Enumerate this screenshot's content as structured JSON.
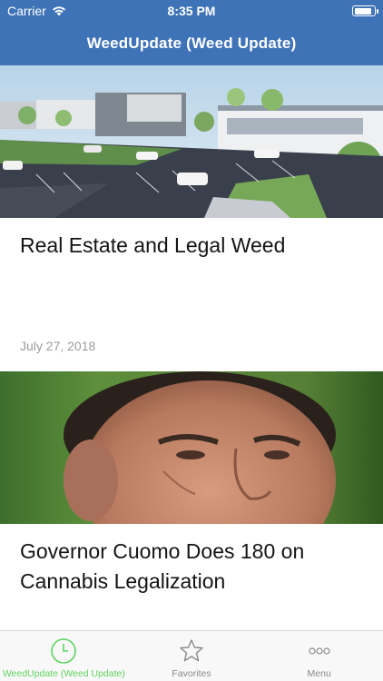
{
  "status_bar": {
    "carrier": "Carrier",
    "time": "8:35 PM",
    "battery_level": 0.9
  },
  "nav": {
    "title": "WeedUpdate (Weed Update)"
  },
  "articles": [
    {
      "title": "Real Estate and Legal Weed",
      "date": "July 27, 2018",
      "image": "building-parking-lot-photo"
    },
    {
      "title": "Governor Cuomo Does 180 on Cannabis Legalization",
      "date": "",
      "image": "man-portrait-photo"
    }
  ],
  "tabs": [
    {
      "label": "WeedUpdate (Weed Update)",
      "icon": "clock-icon",
      "active": true
    },
    {
      "label": "Favorites",
      "icon": "star-icon",
      "active": false
    },
    {
      "label": "Menu",
      "icon": "more-dots-icon",
      "active": false
    }
  ],
  "colors": {
    "nav_blue": "#3f73b8",
    "active_tab": "#5fd35f",
    "inactive_tab": "#8a8a8a",
    "date_gray": "#9a9a9a"
  }
}
